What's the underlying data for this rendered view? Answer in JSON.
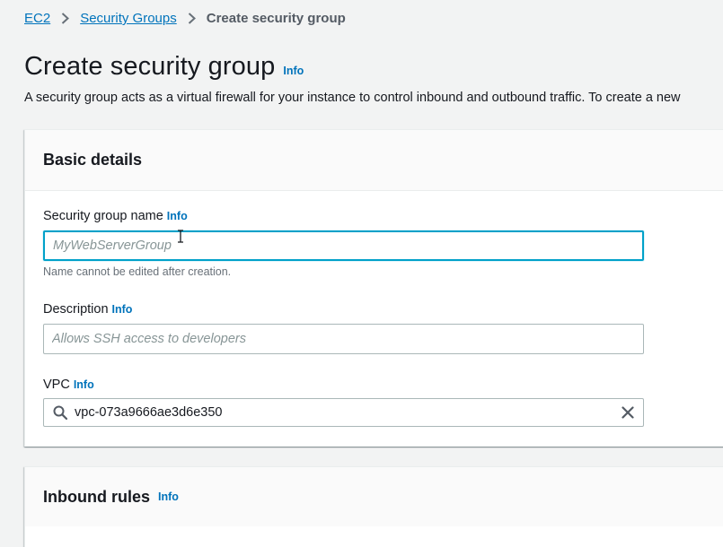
{
  "breadcrumb": {
    "items": [
      {
        "label": "EC2"
      },
      {
        "label": "Security Groups"
      }
    ],
    "current": "Create security group"
  },
  "page": {
    "title": "Create security group",
    "info": "Info",
    "description": "A security group acts as a virtual firewall for your instance to control inbound and outbound traffic. To create a new"
  },
  "basic_details": {
    "heading": "Basic details",
    "name_field": {
      "label": "Security group name",
      "info": "Info",
      "placeholder": "MyWebServerGroup",
      "value": "",
      "constraint": "Name cannot be edited after creation."
    },
    "description_field": {
      "label": "Description",
      "info": "Info",
      "placeholder": "Allows SSH access to developers",
      "value": ""
    },
    "vpc_field": {
      "label": "VPC",
      "info": "Info",
      "value": "vpc-073a9666ae3d6e350"
    }
  },
  "inbound_rules": {
    "heading": "Inbound rules",
    "info": "Info"
  },
  "colors": {
    "link": "#0073bb",
    "focus": "#00a1c9",
    "background": "#f2f3f3"
  },
  "icons": [
    "chevron-right-icon",
    "search-icon",
    "clear-icon",
    "text-cursor-icon"
  ]
}
